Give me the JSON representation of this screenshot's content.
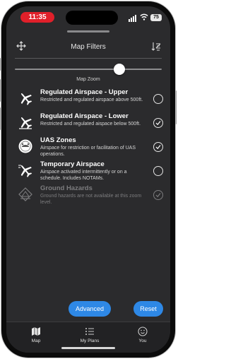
{
  "status_bar": {
    "time": "11:35",
    "battery": "75",
    "time_pill_color": "#e0202a"
  },
  "header": {
    "title": "Map Filters",
    "left_icon": "arrows-expand-icon",
    "right_icon": "sort-icon"
  },
  "zoom": {
    "label": "Map Zoom",
    "level": 0.71
  },
  "layers": [
    {
      "title": "Regulated Airspace - Upper",
      "description": "Restricted and regulated airspace above 500ft.",
      "icon": "airplane-upper-icon",
      "checked": false,
      "enabled": true
    },
    {
      "title": "Regulated Airspace - Lower",
      "description": "Restricted and regulated aispace below 500ft.",
      "icon": "airplane-lower-icon",
      "checked": true,
      "enabled": true
    },
    {
      "title": "UAS Zones",
      "description": "Airspace for restriction or facilitation of UAS operations.",
      "icon": "uas-zone-icon",
      "checked": true,
      "enabled": true
    },
    {
      "title": "Temporary Airspace",
      "description": "Airspace activated intermittently or on a schedule. Includes NOTAMs.",
      "icon": "airplane-temporary-icon",
      "checked": false,
      "enabled": true
    },
    {
      "title": "Ground Hazards",
      "description": "Ground hazards are not available at this zoom level.",
      "icon": "ground-hazard-icon",
      "checked": true,
      "enabled": false
    }
  ],
  "buttons": {
    "advanced": "Advanced",
    "reset": "Reset",
    "accent": "#2e88e6"
  },
  "tabs": [
    {
      "label": "Map",
      "icon": "map-icon"
    },
    {
      "label": "My Plans",
      "icon": "list-icon"
    },
    {
      "label": "You",
      "icon": "smiley-icon"
    }
  ]
}
